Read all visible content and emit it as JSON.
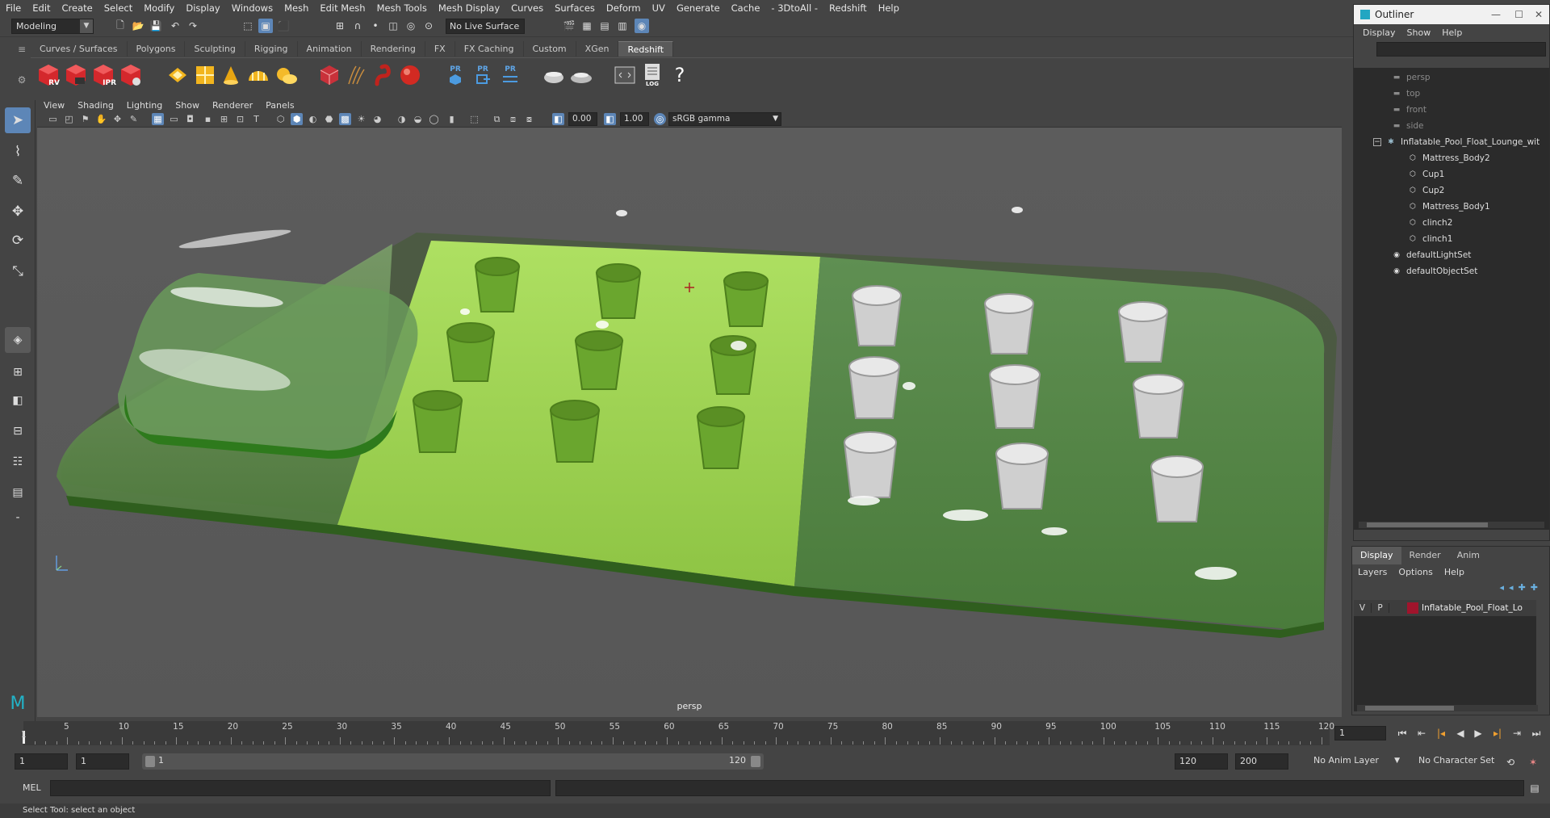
{
  "menubar": [
    "File",
    "Edit",
    "Create",
    "Select",
    "Modify",
    "Display",
    "Windows",
    "Mesh",
    "Edit Mesh",
    "Mesh Tools",
    "Mesh Display",
    "Curves",
    "Surfaces",
    "Deform",
    "UV",
    "Generate",
    "Cache",
    "- 3DtoAll -",
    "Redshift",
    "Help"
  ],
  "status": {
    "mode": "Modeling",
    "live_surface": "No Live Surface"
  },
  "shelf": {
    "tabs": [
      "Curves / Surfaces",
      "Polygons",
      "Sculpting",
      "Rigging",
      "Animation",
      "Rendering",
      "FX",
      "FX Caching",
      "Custom",
      "XGen",
      "Redshift"
    ],
    "active_tab": "Redshift",
    "icon_labels": {
      "rv": "RV",
      "ipr": "IPR",
      "pr1": "PR",
      "pr2": "PR",
      "pr3": "PR",
      "log": "LOG",
      "help": "?"
    }
  },
  "panel": {
    "menu": [
      "View",
      "Shading",
      "Lighting",
      "Show",
      "Renderer",
      "Panels"
    ],
    "exposure": "0.00",
    "gamma": "1.00",
    "colorspace": "sRGB gamma",
    "camera": "persp"
  },
  "outliner": {
    "title": "Outliner",
    "menu": [
      "Display",
      "Show",
      "Help"
    ],
    "items": [
      {
        "label": "persp",
        "type": "camera",
        "dim": true
      },
      {
        "label": "top",
        "type": "camera",
        "dim": true
      },
      {
        "label": "front",
        "type": "camera",
        "dim": true
      },
      {
        "label": "side",
        "type": "camera",
        "dim": true
      },
      {
        "label": "Inflatable_Pool_Float_Lounge_wit",
        "type": "group"
      },
      {
        "label": "Mattress_Body2",
        "type": "mesh"
      },
      {
        "label": "Cup1",
        "type": "mesh"
      },
      {
        "label": "Cup2",
        "type": "mesh"
      },
      {
        "label": "Mattress_Body1",
        "type": "mesh"
      },
      {
        "label": "clinch2",
        "type": "mesh"
      },
      {
        "label": "clinch1",
        "type": "mesh"
      },
      {
        "label": "defaultLightSet",
        "type": "set"
      },
      {
        "label": "defaultObjectSet",
        "type": "set"
      }
    ]
  },
  "layers": {
    "tabs": [
      "Display",
      "Render",
      "Anim"
    ],
    "active_tab": "Display",
    "menu": [
      "Layers",
      "Options",
      "Help"
    ],
    "rows": [
      {
        "v": "V",
        "p": "P",
        "name": "Inflatable_Pool_Float_Lo",
        "color": "#a0142c"
      }
    ]
  },
  "timeline": {
    "ticks": [
      "5",
      "10",
      "15",
      "20",
      "25",
      "30",
      "35",
      "40",
      "45",
      "50",
      "55",
      "60",
      "65",
      "70",
      "75",
      "80",
      "85",
      "90",
      "95",
      "100",
      "105",
      "110",
      "115",
      "120"
    ],
    "start_label": "1",
    "current_frame": "1"
  },
  "range": {
    "start": "1",
    "playback_start": "1",
    "slider_start": "1",
    "slider_end": "120",
    "playback_end": "120",
    "end": "200",
    "anim_layer": "No Anim Layer",
    "character_set": "No Character Set"
  },
  "command": {
    "lang": "MEL"
  },
  "help_line": "Select Tool: select an object",
  "colors": {
    "accent": "#5d86b7",
    "bg": "#444444",
    "viewport": "#5a5a5a"
  }
}
